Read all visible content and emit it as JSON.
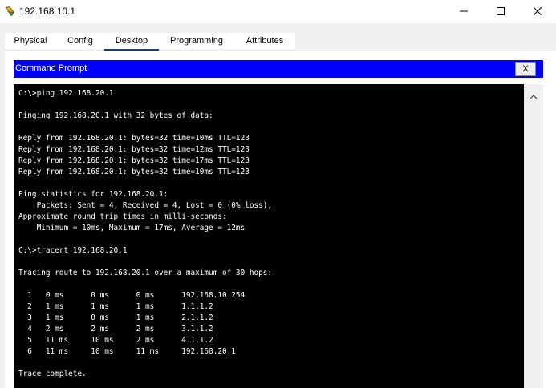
{
  "window": {
    "title": "192.168.10.1",
    "controls": {
      "minimize": "minimize",
      "maximize": "maximize",
      "close": "close"
    }
  },
  "tabs": [
    {
      "label": "Physical",
      "active": false
    },
    {
      "label": "Config",
      "active": false
    },
    {
      "label": "Desktop",
      "active": true
    },
    {
      "label": "Programming",
      "active": false
    },
    {
      "label": "Attributes",
      "active": false
    }
  ],
  "command_prompt": {
    "title": "Command Prompt",
    "close_label": "X",
    "lines": [
      "C:\\>ping 192.168.20.1",
      "",
      "Pinging 192.168.20.1 with 32 bytes of data:",
      "",
      "Reply from 192.168.20.1: bytes=32 time=10ms TTL=123",
      "Reply from 192.168.20.1: bytes=32 time=12ms TTL=123",
      "Reply from 192.168.20.1: bytes=32 time=17ms TTL=123",
      "Reply from 192.168.20.1: bytes=32 time=10ms TTL=123",
      "",
      "Ping statistics for 192.168.20.1:",
      "    Packets: Sent = 4, Received = 4, Lost = 0 (0% loss),",
      "Approximate round trip times in milli-seconds:",
      "    Minimum = 10ms, Maximum = 17ms, Average = 12ms",
      "",
      "C:\\>tracert 192.168.20.1",
      "",
      "Tracing route to 192.168.20.1 over a maximum of 30 hops:",
      "",
      "  1   0 ms      0 ms      0 ms      192.168.10.254",
      "  2   1 ms      1 ms      1 ms      1.1.1.2",
      "  3   1 ms      0 ms      1 ms      2.1.1.2",
      "  4   2 ms      2 ms      2 ms      3.1.1.2",
      "  5   11 ms     10 ms     2 ms      4.1.1.2",
      "  6   11 ms     10 ms     11 ms     192.168.20.1",
      "",
      "Trace complete."
    ]
  },
  "colors": {
    "accent_blue": "#0000ff",
    "terminal_bg": "#000000",
    "terminal_text": "#ffffff",
    "active_tab_underline": "#1a3c78"
  }
}
